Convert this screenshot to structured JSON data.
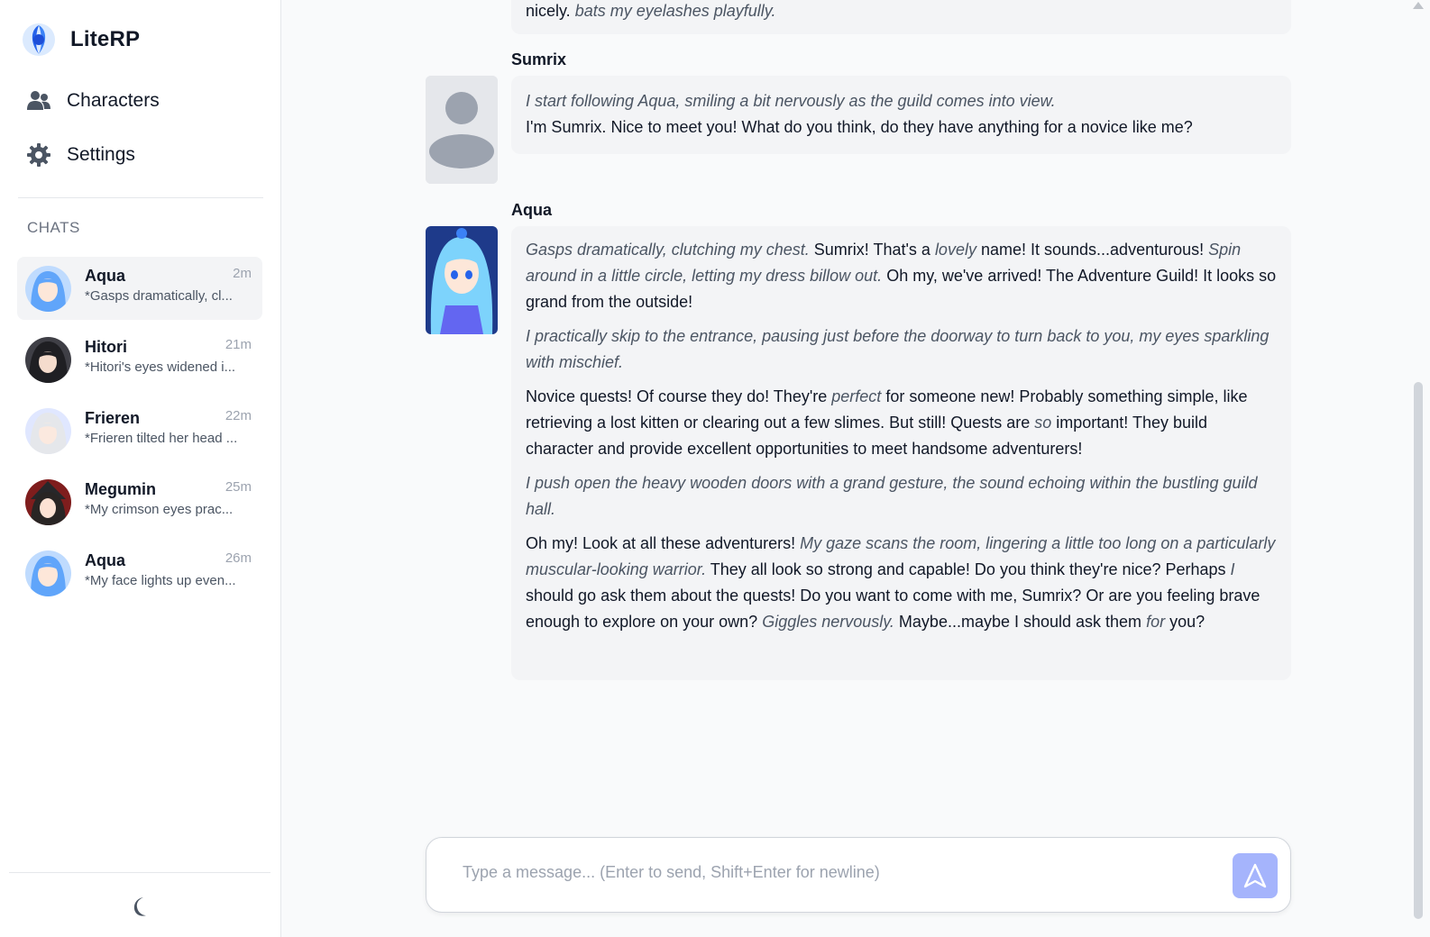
{
  "app": {
    "name": "LiteRP"
  },
  "nav": [
    {
      "label": "Characters",
      "icon": "users-icon"
    },
    {
      "label": "Settings",
      "icon": "gear-icon"
    }
  ],
  "sidebar": {
    "chats_heading": "CHATS"
  },
  "chats": [
    {
      "name": "Aqua",
      "time": "2m",
      "preview": "*Gasps dramatically, cl...",
      "active": true
    },
    {
      "name": "Hitori",
      "time": "21m",
      "preview": "*Hitori's eyes widened i...",
      "active": false
    },
    {
      "name": "Frieren",
      "time": "22m",
      "preview": "*Frieren tilted her head ...",
      "active": false
    },
    {
      "name": "Megumin",
      "time": "25m",
      "preview": "*My crimson eyes prac...",
      "active": false
    },
    {
      "name": "Aqua",
      "time": "26m",
      "preview": "*My face lights up even...",
      "active": false
    }
  ],
  "messages": {
    "prev_tail": {
      "plain": "nicely. ",
      "italic": "bats my eyelashes playfully."
    },
    "sumrix": {
      "author": "Sumrix",
      "line1_italic": "I start following Aqua, smiling a bit nervously as the guild comes into view.",
      "line2": "I'm Sumrix. Nice to meet you! What do you think, do they have anything for a novice like me?"
    },
    "aqua": {
      "author": "Aqua",
      "p1": [
        {
          "t": "Gasps dramatically, clutching my chest.",
          "i": true
        },
        {
          "t": " Sumrix! That's a ",
          "i": false
        },
        {
          "t": "lovely",
          "i": true
        },
        {
          "t": " name! It sounds...adventurous! ",
          "i": false
        },
        {
          "t": "Spin around in a little circle, letting my dress billow out.",
          "i": true
        },
        {
          "t": " Oh my, we've arrived! The Adventure Guild! It looks so grand from the outside!",
          "i": false
        }
      ],
      "p2": [
        {
          "t": "I practically skip to the entrance, pausing just before the doorway to turn back to you, my eyes sparkling with mischief.",
          "i": true
        }
      ],
      "p3": [
        {
          "t": "Novice quests! Of course they do! They're ",
          "i": false
        },
        {
          "t": "perfect",
          "i": true
        },
        {
          "t": " for someone new! Probably something simple, like retrieving a lost kitten or clearing out a few slimes. But still! Quests are ",
          "i": false
        },
        {
          "t": "so",
          "i": true
        },
        {
          "t": " important! They build character and provide excellent opportunities to meet handsome adventurers!",
          "i": false
        }
      ],
      "p4": [
        {
          "t": "I push open the heavy wooden doors with a grand gesture, the sound echoing within the bustling guild hall.",
          "i": true
        }
      ],
      "p5": [
        {
          "t": "Oh my! Look at all these adventurers! ",
          "i": false
        },
        {
          "t": "My gaze scans the room, lingering a little too long on a particularly muscular-looking warrior.",
          "i": true
        },
        {
          "t": " They all look so strong and capable! Do you think they're nice? Perhaps ",
          "i": false
        },
        {
          "t": "I",
          "i": true
        },
        {
          "t": " should go ask them about the quests! Do you want to come with me, Sumrix? Or are you feeling brave enough to explore on your own? ",
          "i": false
        },
        {
          "t": "Giggles nervously.",
          "i": true
        },
        {
          "t": " Maybe...maybe I should ask them ",
          "i": false
        },
        {
          "t": "for",
          "i": true
        },
        {
          "t": " you?",
          "i": false
        }
      ]
    }
  },
  "composer": {
    "placeholder": "Type a message... (Enter to send, Shift+Enter for newline)",
    "send_icon": "send-icon"
  },
  "colors": {
    "accent": "#a5b4fc",
    "bubble": "#f3f4f6",
    "active_chat": "#f3f4f6"
  }
}
